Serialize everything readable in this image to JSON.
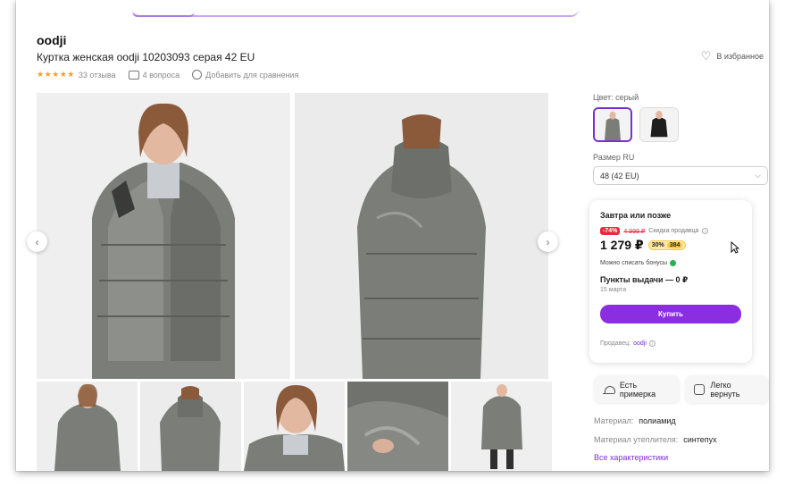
{
  "product": {
    "brand": "oodji",
    "title": "Куртка женская oodji 10203093 серая 42 EU",
    "rating_stars": "★★★★★",
    "reviews": "33 отзыва",
    "questions": "4 вопроса",
    "compare": "Добавить для сравнения",
    "favorite": "В избранное"
  },
  "gallery": {
    "main_photo_count": 2,
    "thumbnail_count": 5
  },
  "options": {
    "color_label": "Цвет: серый",
    "size_label": "Размер RU",
    "size_value": "48 (42 EU)"
  },
  "buy": {
    "delivery": "Завтра или позже",
    "discount": "-74%",
    "old_price": "4 999 ₽",
    "sale_label": "Скидка продавца",
    "price": "1 279 ₽",
    "bonus_percent": "30%",
    "bonus_amount": "384",
    "bonus_note": "Можно списать бонусы",
    "pickup": "Пункты выдачи — 0 ₽",
    "pickup_date": "15 марта",
    "buy_button": "Купить",
    "seller_label": "Продавец:",
    "seller_name": "oodji"
  },
  "perks": {
    "fitting": "Есть примерка",
    "return": "Легко вернуть"
  },
  "specs": {
    "material_label": "Материал:",
    "material_value": "полиамид",
    "filler_label": "Материал утеплителя:",
    "filler_value": "синтепух",
    "all_link": "Все характеристики"
  },
  "colors": {
    "accent": "#8a2ee0",
    "star": "#ff9b2b",
    "discount": "#f0263f",
    "jacket": "#7a7d78"
  }
}
